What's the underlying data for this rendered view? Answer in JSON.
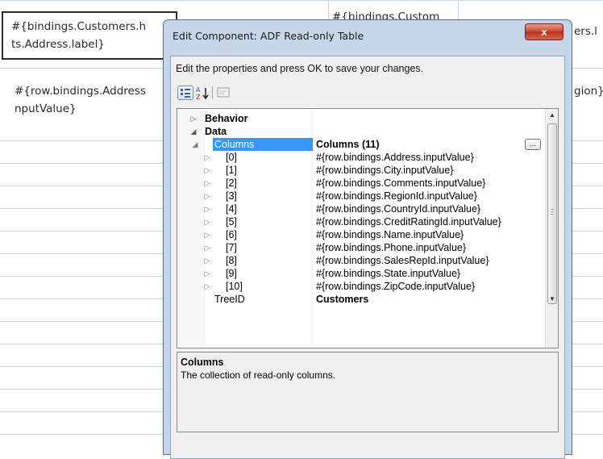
{
  "background": {
    "header_cell_1": "#{bindings.Customers.hints.Address.label}",
    "header_cell_1_line1": "#{bindings.Customers.h",
    "header_cell_1_line2": "ts.Address.label}",
    "header_cell_2": "#{bindings.Custom",
    "header_cell_3": "ers.l",
    "row_cell_1_line1": "#{row.bindings.Address",
    "row_cell_1_line2": "nputValue}",
    "row_cell_3": "gion}"
  },
  "dialog": {
    "title": "Edit Component: ADF Read-only Table",
    "close_label": "x",
    "instructions": "Edit the properties and press OK to save your changes.",
    "toolbar": {
      "categorized_icon": "categorized-icon",
      "alphabetical_label": "A Z",
      "property_pages_icon": "property-pages-icon"
    },
    "properties": {
      "categories": [
        "Behavior",
        "Data"
      ],
      "selected": {
        "name": "Columns",
        "value": "Columns (11)",
        "button": "..."
      },
      "items": [
        {
          "name": "[0]",
          "value": "#{row.bindings.Address.inputValue}"
        },
        {
          "name": "[1]",
          "value": "#{row.bindings.City.inputValue}"
        },
        {
          "name": "[2]",
          "value": "#{row.bindings.Comments.inputValue}"
        },
        {
          "name": "[3]",
          "value": "#{row.bindings.RegionId.inputValue}"
        },
        {
          "name": "[4]",
          "value": "#{row.bindings.CountryId.inputValue}"
        },
        {
          "name": "[5]",
          "value": "#{row.bindings.CreditRatingId.inputValue}"
        },
        {
          "name": "[6]",
          "value": "#{row.bindings.Name.inputValue}"
        },
        {
          "name": "[7]",
          "value": "#{row.bindings.Phone.inputValue}"
        },
        {
          "name": "[8]",
          "value": "#{row.bindings.SalesRepId.inputValue}"
        },
        {
          "name": "[9]",
          "value": "#{row.bindings.State.inputValue}"
        },
        {
          "name": "[10]",
          "value": "#{row.bindings.ZipCode.inputValue}"
        }
      ],
      "tree_id": {
        "name": "TreeID",
        "value": "Customers"
      }
    },
    "help": {
      "title": "Columns",
      "description": "The collection of read-only columns."
    }
  }
}
